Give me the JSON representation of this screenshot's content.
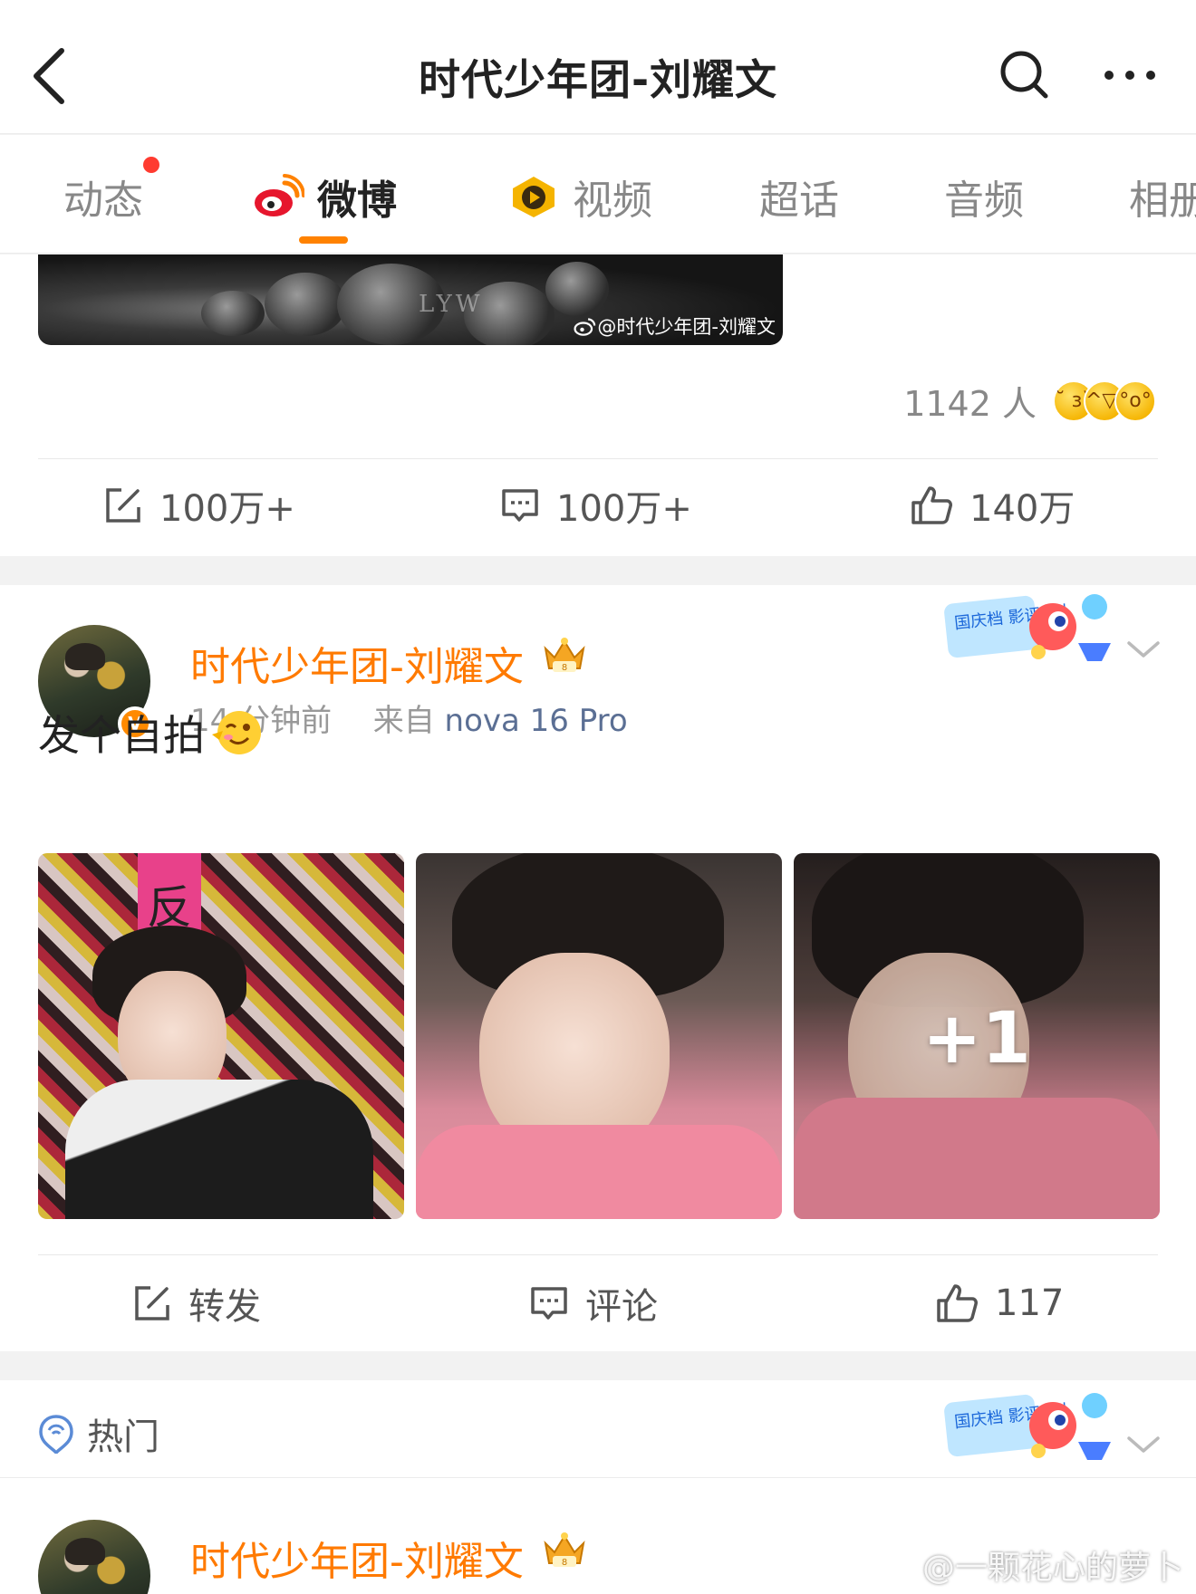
{
  "header": {
    "title": "时代少年团-刘耀文"
  },
  "tabs": [
    {
      "label": "动态"
    },
    {
      "label": "微博"
    },
    {
      "label": "视频"
    },
    {
      "label": "超话"
    },
    {
      "label": "音频"
    },
    {
      "label": "相册"
    }
  ],
  "post1": {
    "image_watermark": "@时代少年团-刘耀文",
    "image_text": "LYW",
    "reaction_count": "1142 人",
    "actions": {
      "repost": "100万+",
      "comment": "100万+",
      "like": "140万"
    }
  },
  "post2": {
    "user_name": "时代少年团-刘耀文",
    "time": "14 分钟前",
    "source_prefix": "来自",
    "source": "nova 16 Pro",
    "text": "发个自拍",
    "photo_overlay": "+1",
    "promo_text": "国庆档 影评达人",
    "verified_badge": "V",
    "actions": {
      "repost": "转发",
      "comment": "评论",
      "like": "117"
    }
  },
  "hot_section": {
    "label": "热门",
    "user_name": "时代少年团-刘耀文",
    "promo_text": "国庆档 影评达人"
  },
  "watermark": "@一颗花心的萝卜",
  "colors": {
    "accent": "#ff8200",
    "username": "#ff7a00",
    "source_link": "#5b6f94",
    "badge": "#ff3b30"
  },
  "icons": [
    "back-icon",
    "search-icon",
    "more-icon",
    "weibo-logo-icon",
    "video-icon",
    "repost-icon",
    "comment-icon",
    "like-icon",
    "chevron-down-icon",
    "hot-icon",
    "crown-icon",
    "wink-emoji-icon"
  ]
}
